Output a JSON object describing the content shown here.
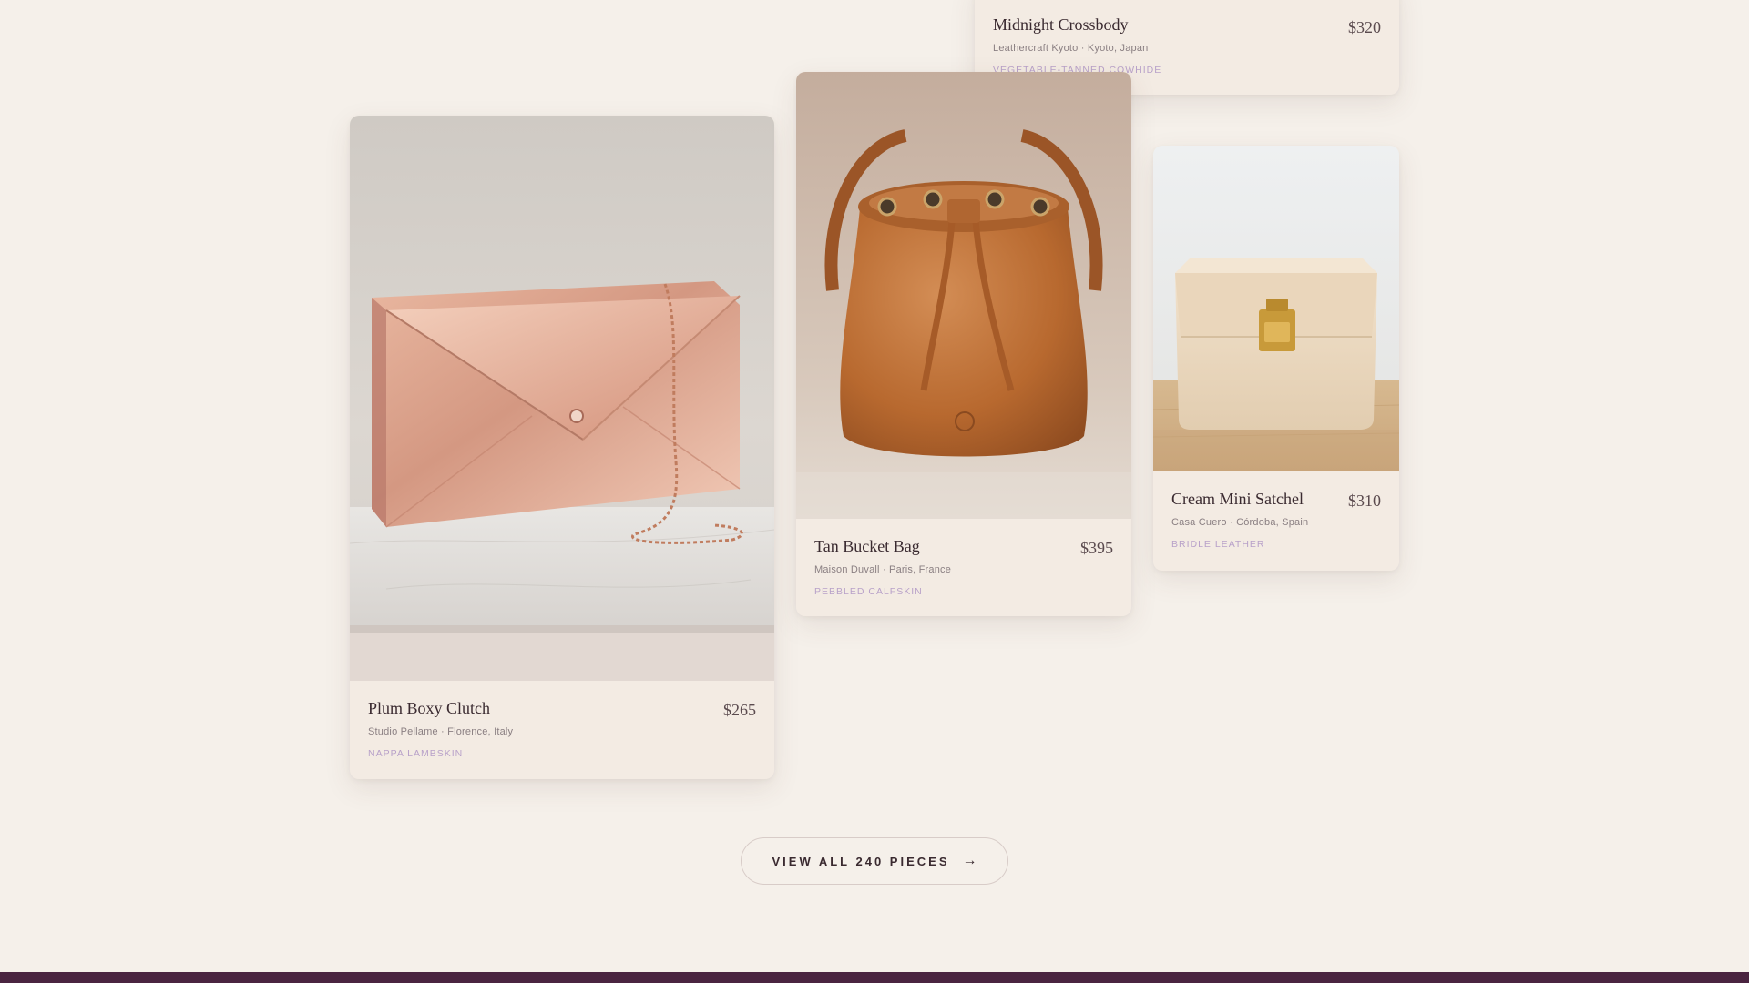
{
  "products": [
    {
      "id": "crossbody",
      "name": "Midnight Crossbody",
      "price": "$320",
      "maker": "Leathercraft Kyoto · Kyoto, Japan",
      "material": "VEGETABLE-TANNED COWHIDE"
    },
    {
      "id": "clutch",
      "name": "Plum Boxy Clutch",
      "price": "$265",
      "maker": "Studio Pellame · Florence, Italy",
      "material": "NAPPA LAMBSKIN"
    },
    {
      "id": "bucket",
      "name": "Tan Bucket Bag",
      "price": "$395",
      "maker": "Maison Duvall · Paris, France",
      "material": "PEBBLED CALFSKIN"
    },
    {
      "id": "satchel",
      "name": "Cream Mini Satchel",
      "price": "$310",
      "maker": "Casa Cuero · Córdoba, Spain",
      "material": "BRIDLE LEATHER"
    }
  ],
  "view_all": {
    "label": "VIEW ALL 240 PIECES",
    "icon": "arrow-right-icon",
    "arrow": "→"
  },
  "colors": {
    "background": "#f5f0ea",
    "card": "#f3ebe3",
    "accent_material": "#b8a1c9",
    "footer": "#4a2440"
  }
}
